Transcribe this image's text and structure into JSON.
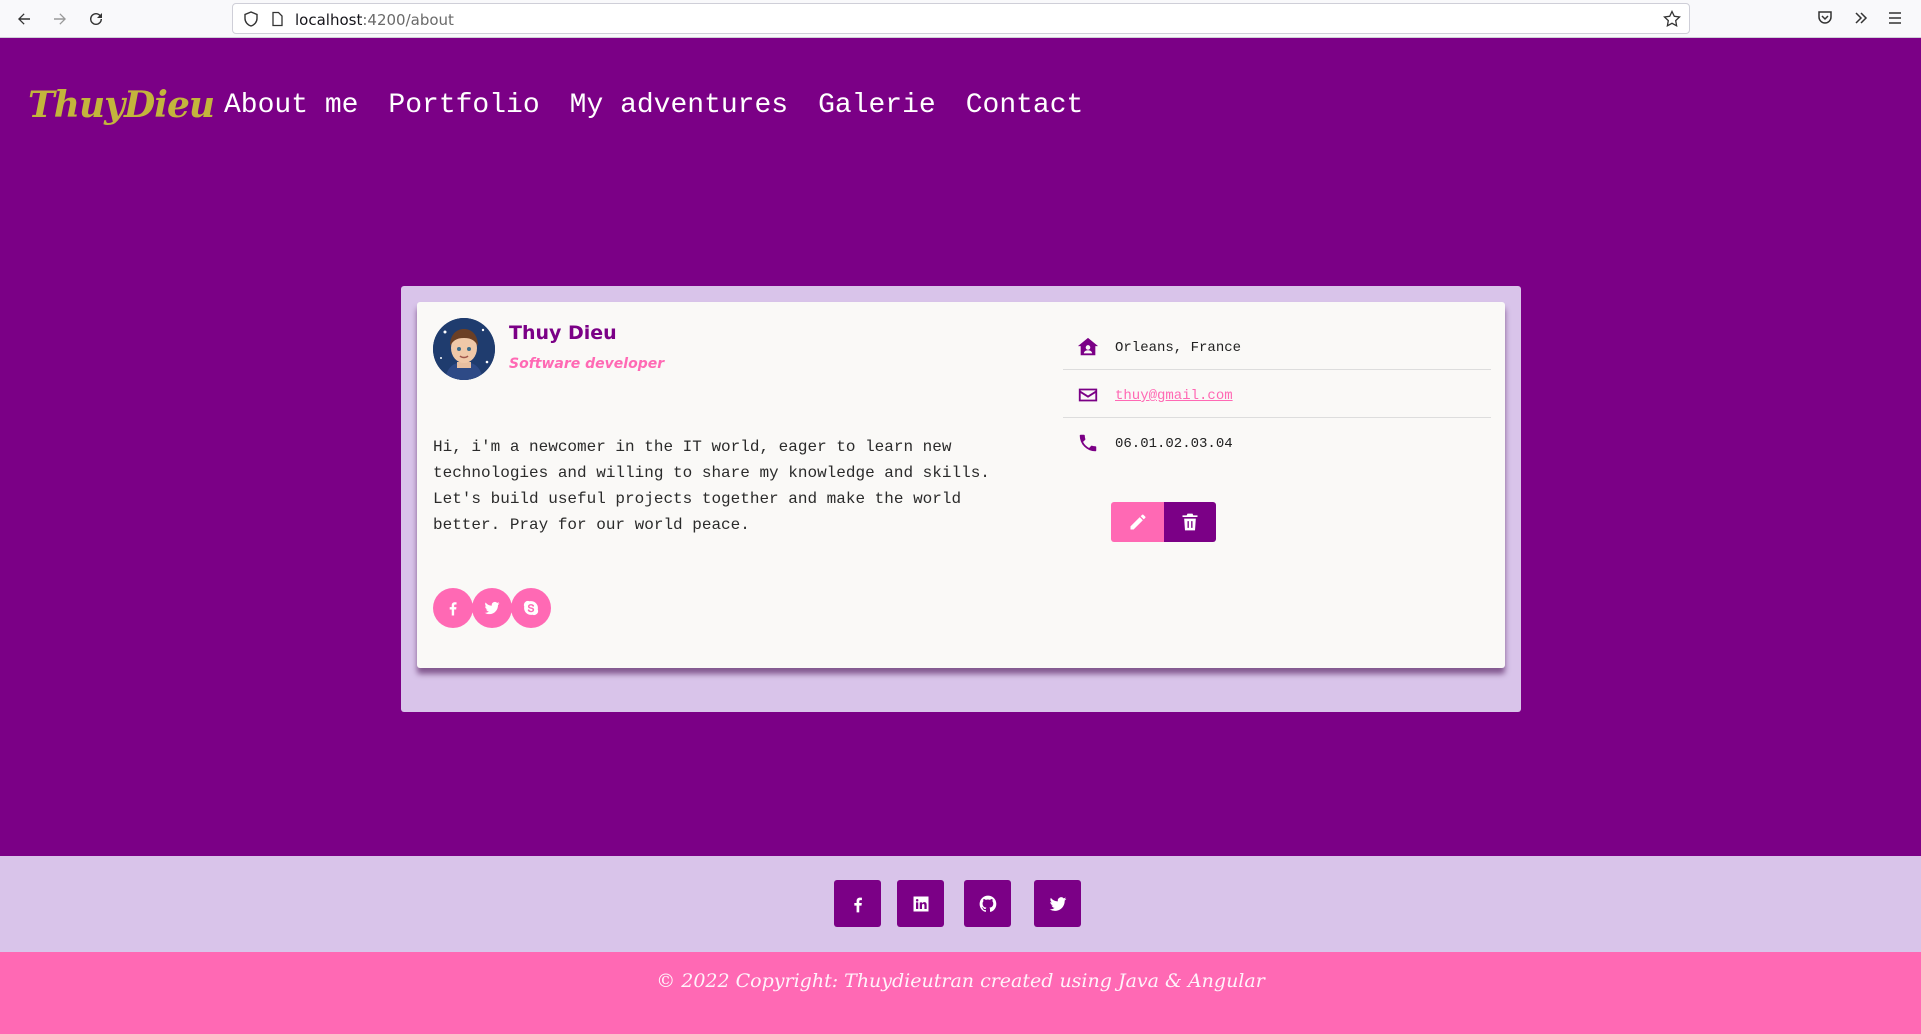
{
  "browser": {
    "url_host": "localhost",
    "url_path": ":4200/about"
  },
  "header": {
    "logo": "ThuyDieu",
    "nav": [
      "About me",
      "Portfolio",
      "My adventures",
      "Galerie",
      "Contact"
    ]
  },
  "profile": {
    "name": "Thuy Dieu",
    "role": "Software developer",
    "bio": "Hi, i'm a newcomer in the IT world, eager to learn new technologies and willing to share my knowledge and skills. Let's build useful projects together and make the world better. Pray for our world peace.",
    "social_icons": [
      "facebook-icon",
      "twitter-icon",
      "skype-icon"
    ],
    "location": "Orleans, France",
    "email": "thuy@gmail.com",
    "phone": "06.01.02.03.04"
  },
  "footer": {
    "social_icons": [
      "facebook-icon",
      "linkedin-icon",
      "github-icon",
      "twitter-icon"
    ],
    "copyright": "© 2022 Copyright: Thuydieutran created using Java & Angular"
  },
  "colors": {
    "primary": "#7b0086",
    "accent": "#ff69b4",
    "light": "#d9c4ea",
    "logo": "#c3b53c"
  }
}
